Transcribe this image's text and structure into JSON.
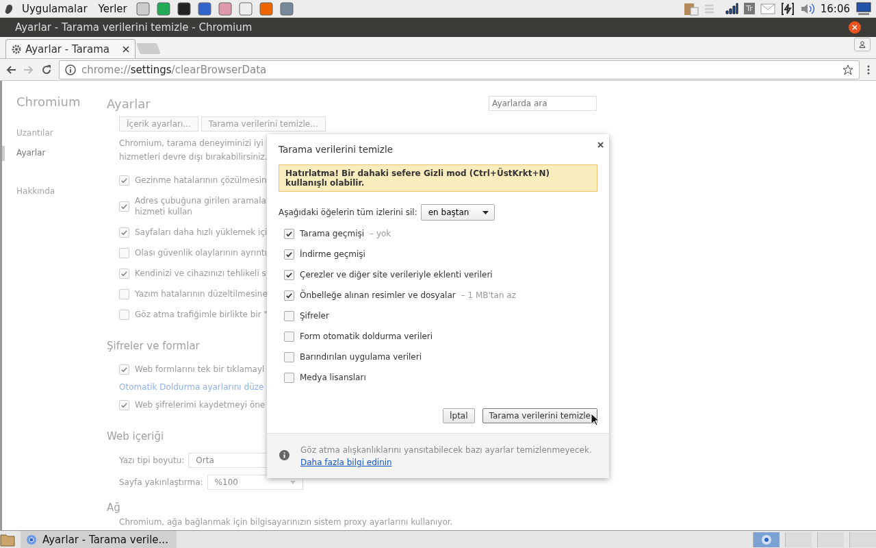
{
  "top_panel": {
    "menus": [
      "Uygulamalar",
      "Yerler"
    ],
    "keyboard_layout": "Tr",
    "clock": "16:06"
  },
  "window": {
    "title": "Ayarlar - Tarama verilerini temizle - Chromium"
  },
  "tabs": [
    {
      "label": "Ayarlar - Tarama",
      "selected": true
    }
  ],
  "address_bar": {
    "scheme": "chrome://",
    "host": "settings",
    "path": "/clearBrowserData"
  },
  "settings_page": {
    "brand": "Chromium",
    "title": "Ayarlar",
    "search": {
      "placeholder": "Ayarlarda ara"
    },
    "sidebar": [
      {
        "label": "Uzantılar",
        "selected": false
      },
      {
        "label": "Ayarlar",
        "selected": true
      },
      {
        "label": "Hakkında",
        "selected": false
      }
    ],
    "rows": [
      {
        "kind": "buttons",
        "labels": [
          "İçerik ayarları...",
          "Tarama verilerini temizle..."
        ]
      },
      {
        "kind": "text",
        "text": "Chromium, tarama deneyiminizi iyi"
      },
      {
        "kind": "text",
        "text": "hizmetleri devre dışı bırakabilirsiniz."
      },
      {
        "kind": "checkbox",
        "label": "Gezinme hatalarının çözülmesin",
        "checked": true
      },
      {
        "kind": "checkbox",
        "label": "Adres çubuğuna girilen aramala\nhizmeti kullan",
        "checked": true
      },
      {
        "kind": "checkbox",
        "label": "Sayfaları daha hızlı yüklemek içi",
        "checked": true
      },
      {
        "kind": "checkbox",
        "label": "Olası güvenlik olaylarının ayrıntı",
        "checked": false
      },
      {
        "kind": "checkbox",
        "label": "Kendinizi ve cihazınızı tehlikeli s",
        "checked": true
      },
      {
        "kind": "checkbox",
        "label": "Yazım hatalarının düzeltilmesine",
        "checked": false
      },
      {
        "kind": "checkbox",
        "label": "Göz atma trafiğimle birlikte bir \"",
        "checked": false
      },
      {
        "kind": "heading",
        "text": "Şifreler ve formlar"
      },
      {
        "kind": "checkbox",
        "label": "Web formlarını tek bir tıklamayl",
        "checked": true
      },
      {
        "kind": "link",
        "text": "Otomatik Doldurma ayarlarını düze"
      },
      {
        "kind": "checkbox",
        "label": "Web şifrelerimi kaydetmeyi öne",
        "checked": true
      },
      {
        "kind": "heading",
        "text": "Web içeriği"
      },
      {
        "kind": "select",
        "label": "Yazı tipi boyutu:",
        "value": "Orta"
      },
      {
        "kind": "select",
        "label": "Sayfa yakınlaştırma:",
        "value": "%100"
      },
      {
        "kind": "heading",
        "text": "Ağ"
      },
      {
        "kind": "text",
        "text": "Chromium, ağa bağlanmak için bilgisayarınızın sistem proxy ayarlarını kullanıyor."
      }
    ]
  },
  "dialog": {
    "title": "Tarama verilerini temizle",
    "notice": "Hatırlatma! Bir dahaki sefere Gizli mod (Ctrl+ÜstKrkt+N) kullanışlı olabilir.",
    "range": {
      "label": "Aşağıdaki öğelerin tüm izlerini sil:",
      "value": "en baştan"
    },
    "items": [
      {
        "label": "Tarama geçmişi",
        "note": "– yok",
        "checked": true
      },
      {
        "label": "İndirme geçmişi",
        "checked": true
      },
      {
        "label": "Çerezler ve diğer site verileriyle eklenti verileri",
        "checked": true
      },
      {
        "label": "Önbelleğe alınan resimler ve dosyalar",
        "note": "– 1 MB'tan az",
        "checked": true
      },
      {
        "label": "Şifreler",
        "checked": false
      },
      {
        "label": "Form otomatik doldurma verileri",
        "checked": false
      },
      {
        "label": "Barındırılan uygulama verileri",
        "checked": false
      },
      {
        "label": "Medya lisansları",
        "checked": false
      }
    ],
    "buttons": [
      {
        "label": "İptal",
        "kind": "cancel"
      },
      {
        "label": "Tarama verilerini temizle",
        "kind": "primary"
      }
    ],
    "footer": {
      "text": "Göz atma alışkanlıklarını yansıtabilecek bazı ayarlar temizlenmeyecek.",
      "link": "Daha fazla bilgi edinin"
    }
  },
  "taskbar": {
    "task": "Ayarlar - Tarama verile...",
    "workspaces": [
      {
        "selected": true
      },
      {
        "selected": false
      },
      {
        "selected": false
      },
      {
        "selected": false
      }
    ]
  }
}
